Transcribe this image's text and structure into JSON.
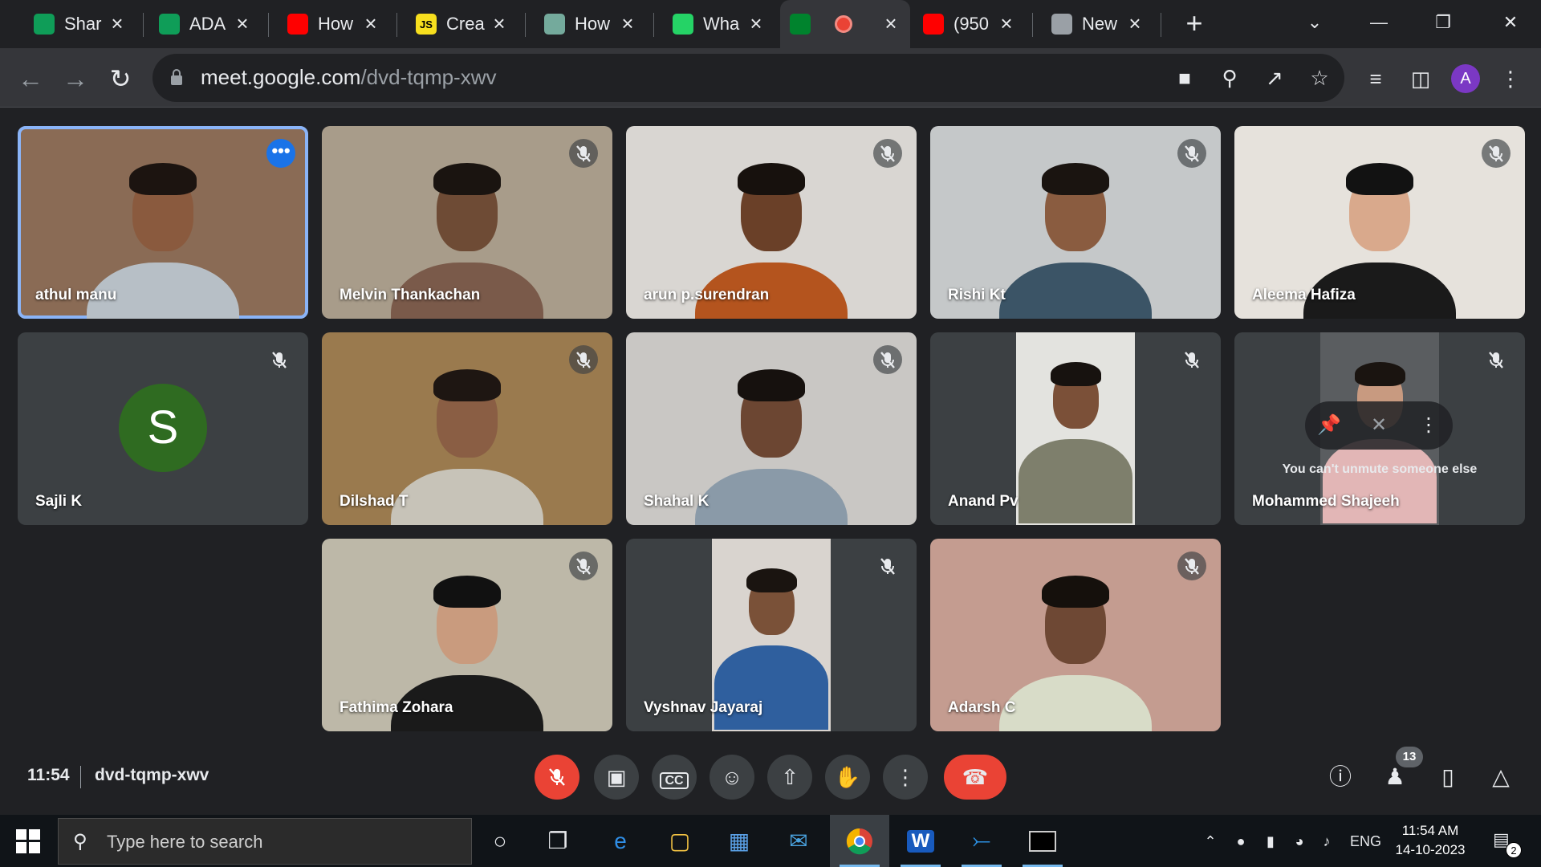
{
  "browser": {
    "tabs": [
      {
        "title": "Shar",
        "icon": "google-drive-icon",
        "color": "#0f9d58"
      },
      {
        "title": "ADA",
        "icon": "google-sheets-icon",
        "color": "#0f9d58"
      },
      {
        "title": "How",
        "icon": "youtube-icon",
        "color": "#ff0000"
      },
      {
        "title": "Crea",
        "icon": "javascript-icon",
        "color": "#f7df1e",
        "glyph": "JS"
      },
      {
        "title": "How",
        "icon": "chatgpt-icon",
        "color": "#74aa9c"
      },
      {
        "title": "Wha",
        "icon": "whatsapp-icon",
        "color": "#25d366"
      },
      {
        "title": "",
        "icon": "google-meet-icon",
        "color": "#00832d"
      },
      {
        "title": "(950",
        "icon": "youtube-icon",
        "color": "#ff0000"
      },
      {
        "title": "New",
        "icon": "chrome-icon",
        "color": "#9aa0a6"
      }
    ],
    "url_host": "meet.google.com",
    "url_path": "/dvd-tqmp-xwv",
    "profile_initial": "A"
  },
  "meeting": {
    "time": "11:54",
    "code": "dvd-tqmp-xwv",
    "people_count": "13",
    "participants": [
      {
        "name": "athul manu",
        "kind": "video",
        "bg": "#8a6b55",
        "skin": "#8a5a3e",
        "hair": "#1c1410",
        "shirt": "#b7bfc6",
        "pinned": true
      },
      {
        "name": "Melvin Thankachan",
        "kind": "video",
        "bg": "#a89c8a",
        "skin": "#6e4b35",
        "hair": "#1a1410",
        "shirt": "#7a5a4a"
      },
      {
        "name": "arun p.surendran",
        "kind": "video",
        "bg": "#d9d6d2",
        "skin": "#6a4028",
        "hair": "#17110d",
        "shirt": "#b4541e"
      },
      {
        "name": "Rishi Kt",
        "kind": "video",
        "bg": "#c5c8c9",
        "skin": "#8a5c40",
        "hair": "#1a1410",
        "shirt": "#3b5466"
      },
      {
        "name": "Aleema Hafiza",
        "kind": "video",
        "bg": "#e6e2dc",
        "skin": "#d9a98c",
        "hair": "#121212",
        "shirt": "#1a1a1a"
      },
      {
        "name": "Sajli K",
        "kind": "avatar",
        "initial": "S",
        "avatar_color": "#2f6b21"
      },
      {
        "name": "Dilshad T",
        "kind": "video",
        "bg": "#9a7a4e",
        "skin": "#8a5e44",
        "hair": "#1e1612",
        "shirt": "#c7c3b8"
      },
      {
        "name": "Shahal K",
        "kind": "video",
        "bg": "#c9c7c4",
        "skin": "#6c4632",
        "hair": "#16110e",
        "shirt": "#8a9aa8"
      },
      {
        "name": "Anand Pv",
        "kind": "portrait",
        "bg": "#e3e3df",
        "skin": "#7b5038",
        "hair": "#17120f",
        "shirt": "#7e7f6c"
      },
      {
        "name": "Mohammed Shajeeh",
        "kind": "portrait-hover",
        "bg": "#5a5d60",
        "skin": "#c89a80",
        "hair": "#1a1410",
        "shirt": "#e2b6b6",
        "hover_message": "You can't unmute someone else"
      },
      {
        "name": "Fathima Zohara",
        "kind": "video",
        "bg": "#bdb8a8",
        "skin": "#c99b7e",
        "hair": "#111111",
        "shirt": "#1a1a1a"
      },
      {
        "name": "Vyshnav Jayaraj",
        "kind": "portrait",
        "bg": "#d9d4cf",
        "skin": "#7a5138",
        "hair": "#1a1410",
        "shirt": "#2f5f9e"
      },
      {
        "name": "Adarsh C",
        "kind": "video",
        "bg": "#c49c90",
        "skin": "#6e4834",
        "hair": "#15100c",
        "shirt": "#d8dcc8"
      }
    ]
  },
  "taskbar": {
    "search_placeholder": "Type here to search",
    "language": "ENG",
    "time": "11:54 AM",
    "date": "14-10-2023",
    "notification_count": "2"
  },
  "colors": {
    "accent_blue": "#8ab4f8",
    "end_call_red": "#ea4335"
  }
}
